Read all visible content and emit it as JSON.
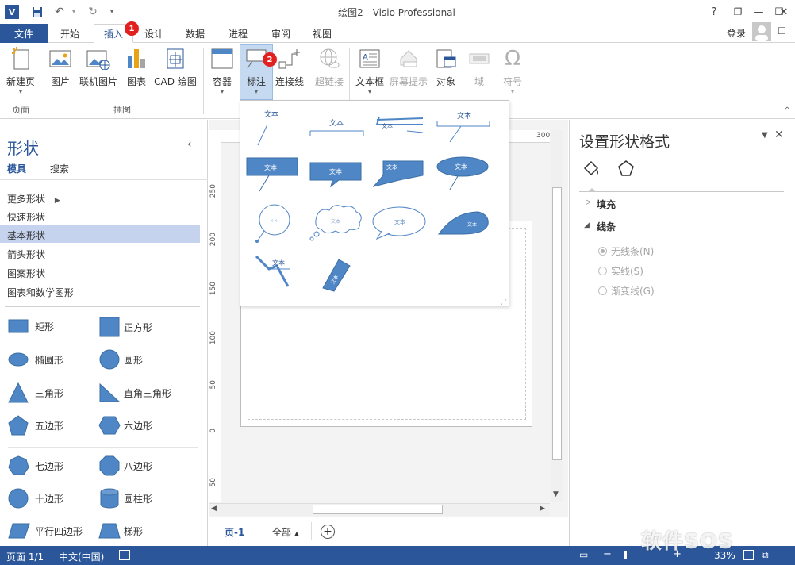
{
  "titlebar": {
    "app_icon": "V",
    "doc_title": "绘图2 - Visio Professional",
    "help": "?",
    "restore": "❐",
    "minimize": "—",
    "maximize": "☐",
    "close": "✕"
  },
  "tabs": [
    "文件",
    "开始",
    "插入",
    "设计",
    "数据",
    "进程",
    "审阅",
    "视图"
  ],
  "login": "登录",
  "badges": {
    "insert": "1",
    "callout": "2"
  },
  "ribbon": {
    "new_page": "新建页",
    "picture": "图片",
    "online_picture": "联机图片",
    "chart": "图表",
    "cad": "CAD 绘图",
    "container": "容器",
    "callout": "标注",
    "connector": "连接线",
    "hyperlink": "超链接",
    "textbox": "文本框",
    "screentip": "屏幕提示",
    "object": "对象",
    "field": "域",
    "symbol": "符号",
    "group_pages": "页面",
    "group_illustrations": "插图"
  },
  "shapes_pane": {
    "title": "形状",
    "tab_stencils": "模具",
    "tab_search": "搜索",
    "stencils": [
      "更多形状",
      "快速形状",
      "基本形状",
      "箭头形状",
      "图案形状",
      "图表和数学图形"
    ],
    "shapes": [
      "矩形",
      "正方形",
      "椭圆形",
      "圆形",
      "三角形",
      "直角三角形",
      "五边形",
      "六边形",
      "七边形",
      "八边形",
      "十边形",
      "圆柱形",
      "平行四边形",
      "梯形"
    ]
  },
  "gallery": {
    "callout_text": "文本",
    "small_text": "××"
  },
  "ruler": {
    "top": [
      "300"
    ],
    "left": [
      "250",
      "200",
      "150",
      "100",
      "50",
      "0",
      "50"
    ]
  },
  "page_tabs": {
    "page": "页-1",
    "all": "全部"
  },
  "format_pane": {
    "title": "设置形状格式",
    "fill": "填充",
    "line": "线条",
    "options": [
      "无线条(N)",
      "实线(S)",
      "渐变线(G)"
    ]
  },
  "statusbar": {
    "page": "页面 1/1",
    "language": "中文(中国)",
    "zoom": "33%"
  },
  "watermark": "软件SOS",
  "colors": {
    "accent": "#2b579a",
    "badge": "#e1211f",
    "shape_fill": "#4f86c6"
  }
}
